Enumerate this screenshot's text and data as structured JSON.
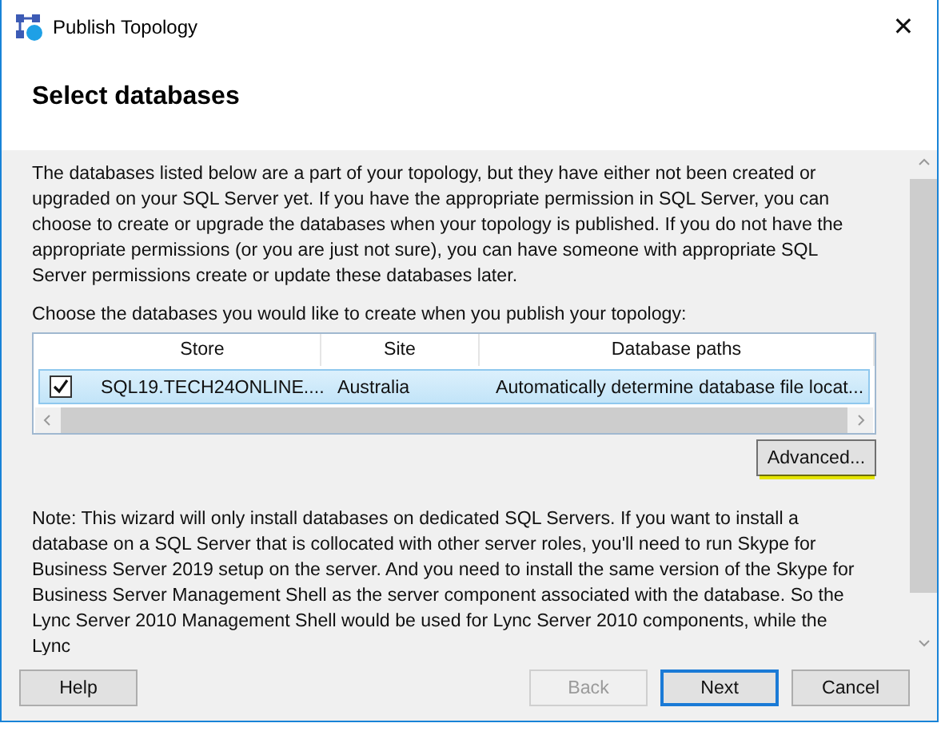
{
  "window": {
    "title": "Publish Topology",
    "close": "✕"
  },
  "heading": "Select databases",
  "intro": "The databases listed below are a part of your topology, but they have either not been created or upgraded on your SQL Server yet. If you have the appropriate permission in SQL Server, you can choose to create or upgrade the databases when your topology is published. If you do not have the appropriate permissions (or you are just not sure), you can have someone with appropriate SQL Server permissions create or update these databases later.",
  "prompt": "Choose the databases you would like to create when you publish your topology:",
  "table": {
    "columns": [
      "Store",
      "Site",
      "Database paths"
    ],
    "rows": [
      {
        "checked": true,
        "selected": true,
        "cells": [
          "SQL19.TECH24ONLINE....",
          "Australia",
          "Automatically determine database file locat..."
        ]
      }
    ]
  },
  "advanced_button": {
    "label": "Advanced...",
    "highlighted": true
  },
  "note": "Note: This wizard will only install databases on dedicated SQL Servers. If you want to install a database on a SQL Server that is collocated with other server roles, you'll need to run Skype for Business Server 2019 setup on the server. And you need to install the same version of the Skype for Business Server Management Shell as the server component associated with the database. So the Lync Server 2010 Management Shell would be used for Lync Server 2010 components, while the Lync",
  "buttons": [
    {
      "label": "Help",
      "disabled": false,
      "default": false
    },
    {
      "label": "Back",
      "disabled": true,
      "default": false
    },
    {
      "label": "Next",
      "disabled": false,
      "default": true
    },
    {
      "label": "Cancel",
      "disabled": false,
      "default": false
    }
  ]
}
